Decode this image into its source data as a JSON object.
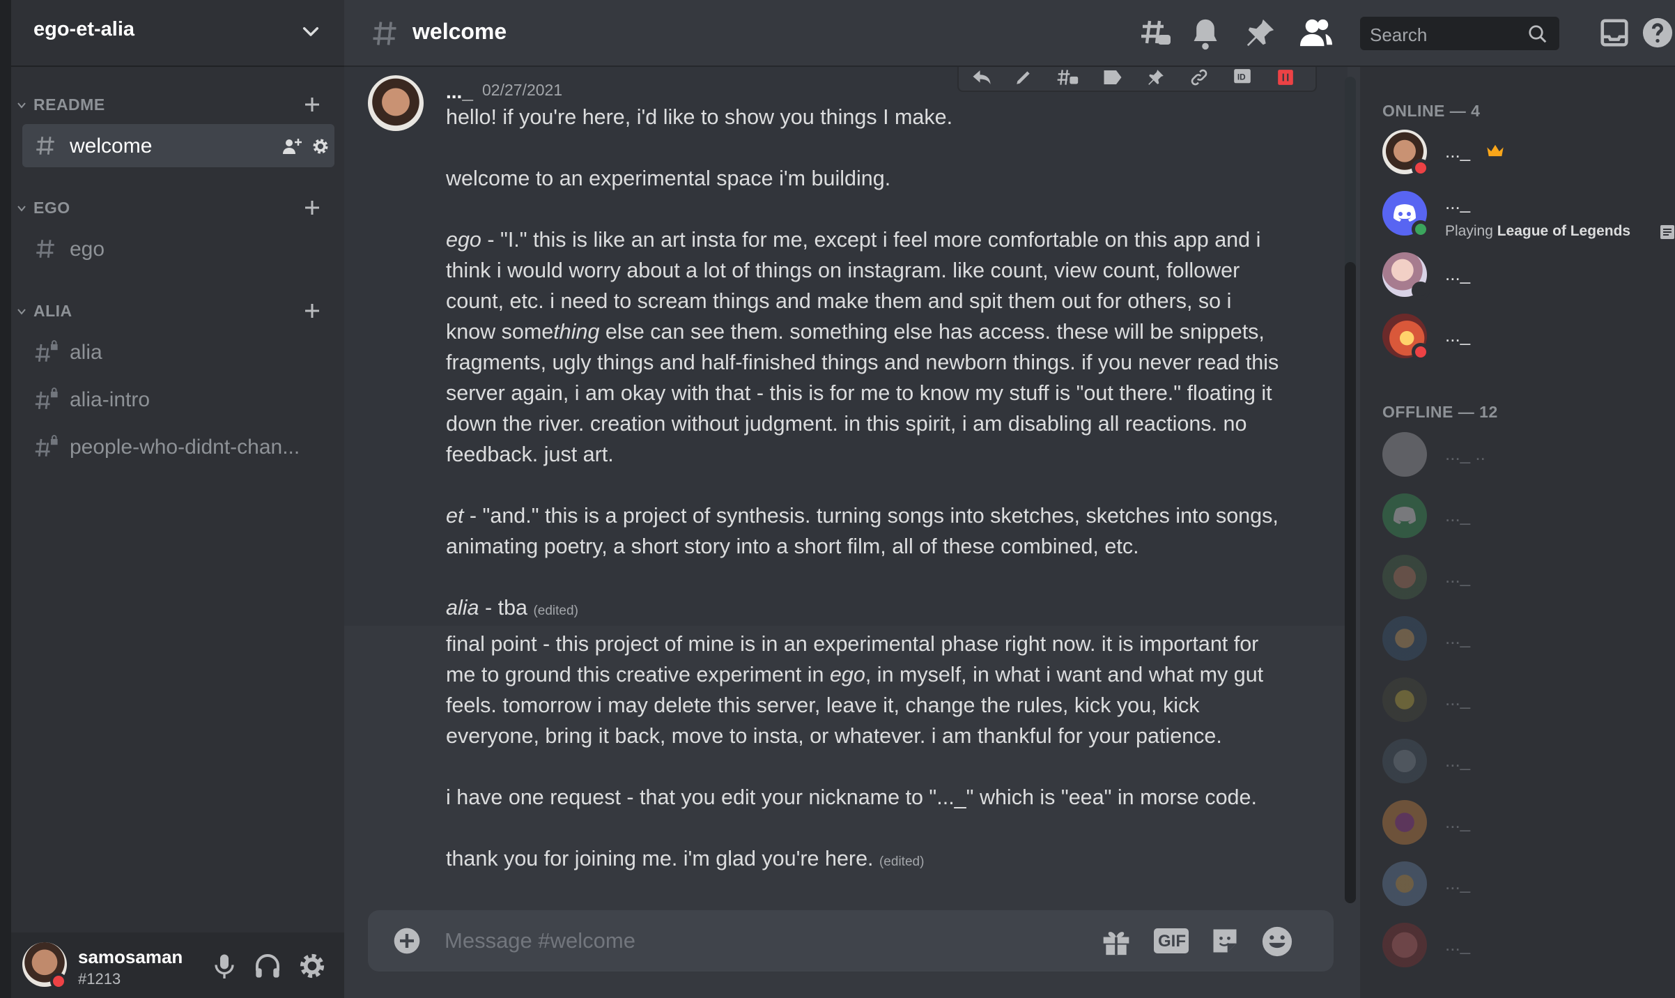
{
  "server": {
    "name": "ego-et-alia"
  },
  "categories": [
    {
      "label": "README",
      "channels": [
        {
          "name": "welcome",
          "active": true
        }
      ]
    },
    {
      "label": "EGO",
      "channels": [
        {
          "name": "ego"
        }
      ]
    },
    {
      "label": "ALIA",
      "channels": [
        {
          "name": "alia"
        },
        {
          "name": "alia-intro"
        },
        {
          "name": "people-who-didnt-chan..."
        }
      ]
    }
  ],
  "user": {
    "name": "samosaman",
    "tag": "#1213"
  },
  "channel": {
    "title": "welcome"
  },
  "search": {
    "placeholder": "Search"
  },
  "message": {
    "author": "..._",
    "timestamp": "02/27/2021",
    "lines": {
      "l1": "hello! if you're here, i'd like to show you things I make.",
      "l2": "welcome to an experimental space i'm building.",
      "l3a": "ego",
      "l3b": " - \"I.\" this is like an art insta for me, except i feel more comfortable on this app and i",
      "l4": "think i would worry about a lot of things on instagram. like count, view count, follower",
      "l5": "count, etc. i need to scream things and make them and spit them out for others, so i",
      "l6a": "know some",
      "l6b": "thing",
      "l6c": " else can see them. something else has access. these will be snippets,",
      "l7": "fragments, ugly things and half-finished things and newborn things. if you never read this",
      "l8": "server again, i am okay with that - this is for me to know my stuff is \"out there.\" floating it",
      "l9": "down the river. creation without judgment. in this spirit, i am disabling all reactions. no",
      "l10": "feedback. just art.",
      "l11a": "et",
      "l11b": " - \"and.\" this is a project of synthesis. turning songs into sketches, sketches into songs,",
      "l12": "animating poetry, a short story into a short film, all of these combined, etc.",
      "l13a": "alia",
      "l13b": " - tba ",
      "edited": "(edited)",
      "l14": "final point - this project of mine is in an experimental phase right now. it is important for",
      "l15a": "me to ground this creative experiment in ",
      "l15b": "ego",
      "l15c": ", in myself, in what i want and what my gut",
      "l16": "feels. tomorrow i may delete this server, leave it, change the rules, kick you, kick",
      "l17": "everyone, bring it back, move to insta, or whatever. i am thankful for your patience.",
      "l18": "i have one request - that you edit your nickname to \"..._\" which is \"eea\" in morse code.",
      "l19": "thank you for joining me. i'm glad you're here. "
    }
  },
  "composer": {
    "placeholder": "Message #welcome",
    "gif_label": "GIF"
  },
  "members": {
    "online_header": "ONLINE — 4",
    "offline_header": "OFFLINE — 12",
    "online": [
      {
        "name": "..._",
        "status": "dnd",
        "crown": true
      },
      {
        "name": "..._",
        "status": "online",
        "activity_prefix": "Playing ",
        "activity": "League of Legends"
      },
      {
        "name": "..._",
        "status": "idle"
      },
      {
        "name": "..._",
        "status": "dnd"
      }
    ],
    "offline": [
      {
        "name": "..._ .."
      },
      {
        "name": "..._"
      },
      {
        "name": "..._"
      },
      {
        "name": "..._"
      },
      {
        "name": "..._"
      },
      {
        "name": "..._"
      },
      {
        "name": "..._"
      },
      {
        "name": "..._"
      },
      {
        "name": "..._"
      }
    ]
  },
  "colors": {
    "online": "#3ba55d",
    "dnd": "#ed4245",
    "idle": "#faa81a",
    "blurple": "#5865f2",
    "crown": "#faa61a"
  }
}
